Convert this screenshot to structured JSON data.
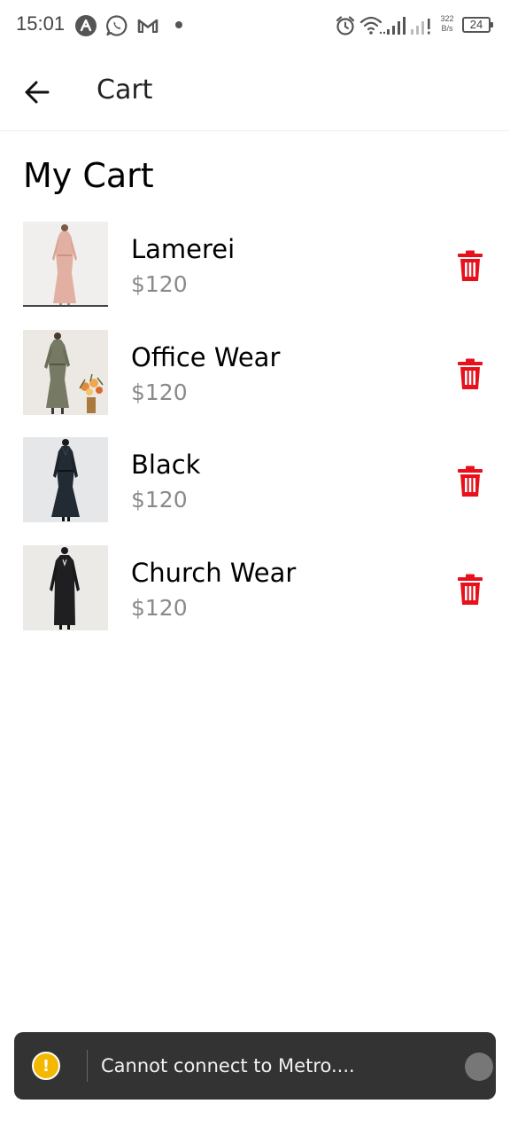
{
  "status_bar": {
    "time": "15:01",
    "net_speed_value": "322",
    "net_speed_unit": "B/s",
    "battery": "24",
    "left_icons": [
      "arch-icon",
      "whatsapp-icon",
      "gmail-icon"
    ],
    "right_icons": [
      "alarm-icon",
      "wifi-icon",
      "signal-icon"
    ]
  },
  "app_bar": {
    "title": "Cart",
    "back_icon": "arrow-left-icon"
  },
  "main": {
    "title": "My Cart",
    "items": [
      {
        "name": "Lamerei",
        "price": "$120",
        "image": "dress-pink"
      },
      {
        "name": "Office Wear",
        "price": "$120",
        "image": "dress-olive"
      },
      {
        "name": "Black",
        "price": "$120",
        "image": "dress-black"
      },
      {
        "name": "Church Wear",
        "price": "$120",
        "image": "dress-black-long-sleeve"
      }
    ],
    "delete_icon": "trash-icon",
    "delete_color": "#e8101b"
  },
  "toast": {
    "text": "Cannot connect to Metro....",
    "icon_symbol": "!",
    "icon_color": "#f5b800"
  }
}
